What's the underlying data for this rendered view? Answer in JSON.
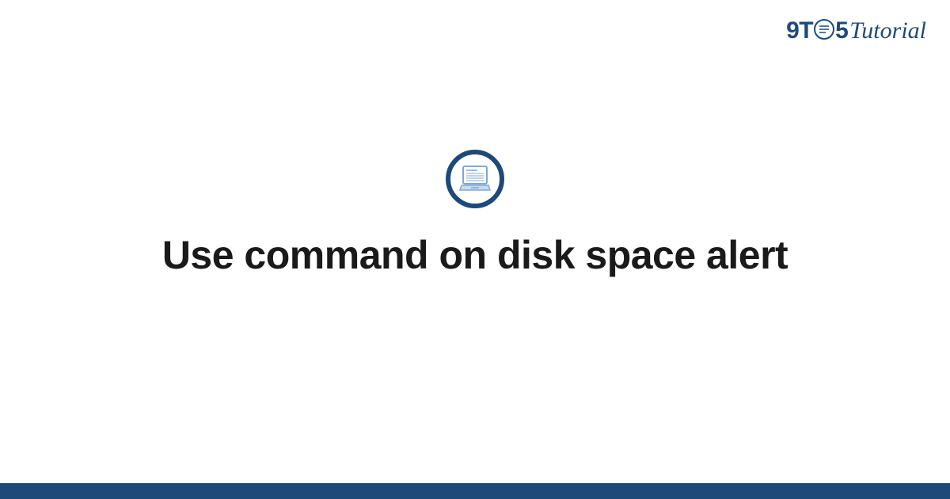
{
  "header": {
    "logo_part1": "9T",
    "logo_part2": "5",
    "logo_tutorial": "Tutorial"
  },
  "main": {
    "title": "Use command on disk space alert"
  },
  "colors": {
    "brand": "#1e4a7a",
    "text": "#1a1a1a"
  }
}
